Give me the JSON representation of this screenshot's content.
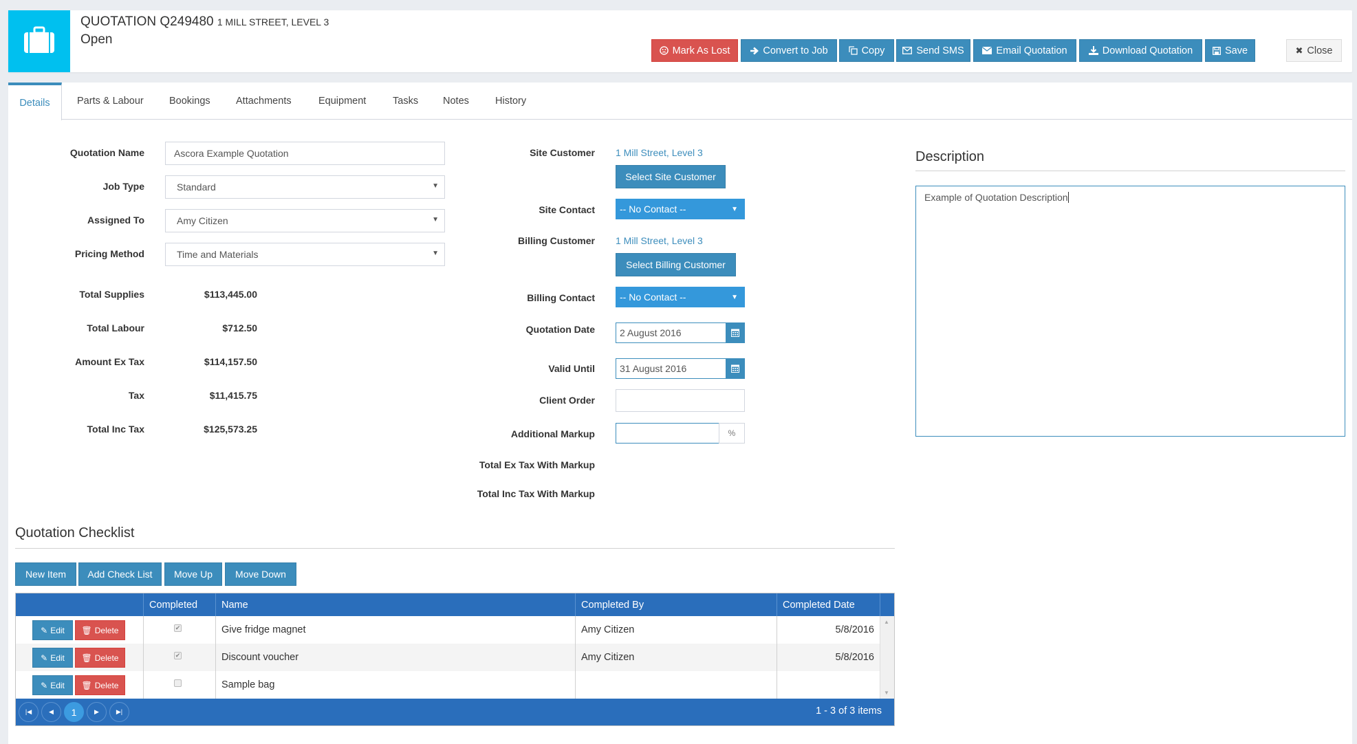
{
  "header": {
    "icon": "briefcase-icon",
    "title": "QUOTATION Q249480",
    "subtitle": "1 MILL STREET, LEVEL 3",
    "status": "Open",
    "icon_bg": "#00c0ef"
  },
  "toolbar": {
    "mark_as_lost": {
      "label": "Mark As Lost",
      "icon": "frown-icon"
    },
    "convert_to_job": {
      "label": "Convert to Job",
      "icon": "arrow-right-icon"
    },
    "copy": {
      "label": "Copy",
      "icon": "copy-icon"
    },
    "send_sms": {
      "label": "Send SMS",
      "icon": "envelope-outline-icon"
    },
    "email_quotation": {
      "label": "Email Quotation",
      "icon": "envelope-icon"
    },
    "download_quotation": {
      "label": "Download Quotation",
      "icon": "download-icon"
    },
    "save": {
      "label": "Save",
      "icon": "floppy-icon"
    },
    "close": {
      "label": "Close",
      "icon": "close-icon"
    }
  },
  "tabs": [
    {
      "label": "Details",
      "active": true
    },
    {
      "label": "Parts & Labour"
    },
    {
      "label": "Bookings"
    },
    {
      "label": "Attachments"
    },
    {
      "label": "Equipment"
    },
    {
      "label": "Tasks"
    },
    {
      "label": "Notes"
    },
    {
      "label": "History"
    }
  ],
  "details": {
    "quotation_name": {
      "label": "Quotation Name",
      "value": "Ascora Example Quotation"
    },
    "job_type": {
      "label": "Job Type",
      "value": "Standard"
    },
    "assigned_to": {
      "label": "Assigned To",
      "value": "Amy Citizen"
    },
    "pricing_method": {
      "label": "Pricing Method",
      "value": "Time and Materials"
    },
    "totals": [
      {
        "label": "Total Supplies",
        "value": "$113,445.00"
      },
      {
        "label": "Total Labour",
        "value": "$712.50"
      },
      {
        "label": "Amount Ex Tax",
        "value": "$114,157.50"
      },
      {
        "label": "Tax",
        "value": "$11,415.75"
      },
      {
        "label": "Total Inc Tax",
        "value": "$125,573.25"
      }
    ]
  },
  "customer": {
    "site_customer": {
      "label": "Site Customer",
      "value": "1 Mill Street, Level 3",
      "button": "Select Site Customer"
    },
    "site_contact": {
      "label": "Site Contact",
      "value": "-- No Contact --"
    },
    "billing_customer": {
      "label": "Billing Customer",
      "value": "1 Mill Street, Level 3",
      "button": "Select Billing Customer"
    },
    "billing_contact": {
      "label": "Billing Contact",
      "value": "-- No Contact --"
    },
    "quotation_date": {
      "label": "Quotation Date",
      "value": "2 August 2016"
    },
    "valid_until": {
      "label": "Valid Until",
      "value": "31 August 2016"
    },
    "client_order": {
      "label": "Client Order",
      "value": ""
    },
    "additional_markup": {
      "label": "Additional Markup",
      "value": "",
      "suffix": "%"
    },
    "total_ex_tax_markup": {
      "label": "Total Ex Tax With Markup",
      "value": ""
    },
    "total_inc_tax_markup": {
      "label": "Total Inc Tax With Markup",
      "value": ""
    }
  },
  "description": {
    "heading": "Description",
    "value": "Example of Quotation Description"
  },
  "checklist": {
    "heading": "Quotation Checklist",
    "buttons": {
      "new_item": "New Item",
      "add_check_list": "Add Check List",
      "move_up": "Move Up",
      "move_down": "Move Down"
    },
    "columns": [
      "",
      "Completed",
      "Name",
      "Completed By",
      "Completed Date"
    ],
    "edit_label": "Edit",
    "delete_label": "Delete",
    "rows": [
      {
        "completed": true,
        "name": "Give fridge magnet",
        "completed_by": "Amy Citizen",
        "completed_date": "5/8/2016"
      },
      {
        "completed": true,
        "name": "Discount voucher",
        "completed_by": "Amy Citizen",
        "completed_date": "5/8/2016"
      },
      {
        "completed": false,
        "name": "Sample bag",
        "completed_by": "",
        "completed_date": ""
      }
    ],
    "pager": {
      "current_page": "1",
      "info": "1 - 3 of 3 items"
    }
  },
  "colors": {
    "primary": "#3c8dbc",
    "danger": "#d9534f",
    "grid_header": "#2a6ebb",
    "dropdown": "#3498db"
  }
}
